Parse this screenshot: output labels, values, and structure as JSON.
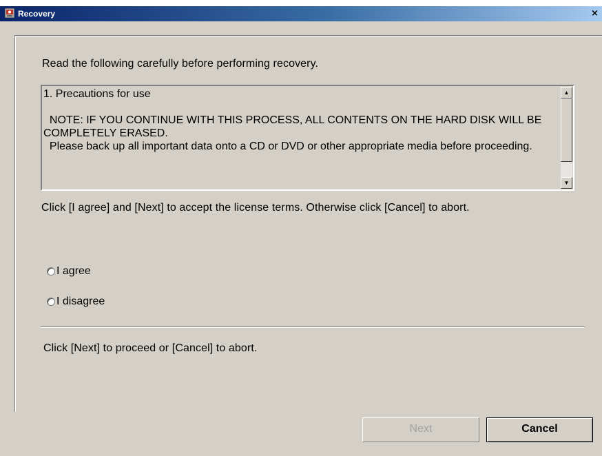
{
  "window": {
    "title": "Recovery",
    "close_glyph": "×"
  },
  "content": {
    "instruction": "Read the following carefully before performing recovery.",
    "terms_text": "1. Precautions for use\n\n  NOTE: IF YOU CONTINUE WITH THIS PROCESS, ALL CONTENTS ON THE HARD DISK WILL BE COMPLETELY ERASED.\n  Please back up all important data onto a CD or DVD or other appropriate media before proceeding.",
    "accept_prompt": "Click [I agree] and [Next] to accept the license terms. Otherwise click [Cancel] to abort.",
    "options": [
      {
        "label": "I agree",
        "selected": false
      },
      {
        "label": "I disagree",
        "selected": false
      }
    ],
    "proceed_prompt": "Click [Next] to proceed or [Cancel] to abort."
  },
  "scrollbar": {
    "up_glyph": "▲",
    "down_glyph": "▼"
  },
  "buttons": {
    "next_label": "Next",
    "next_enabled": false,
    "cancel_label": "Cancel"
  },
  "colors": {
    "face": "#d4d0c8",
    "title_start": "#0a246a",
    "title_end": "#a6caf0",
    "disabled_text": "#a0a0a0"
  },
  "icons": {
    "app": "recovery-app-icon",
    "close": "close-icon"
  }
}
